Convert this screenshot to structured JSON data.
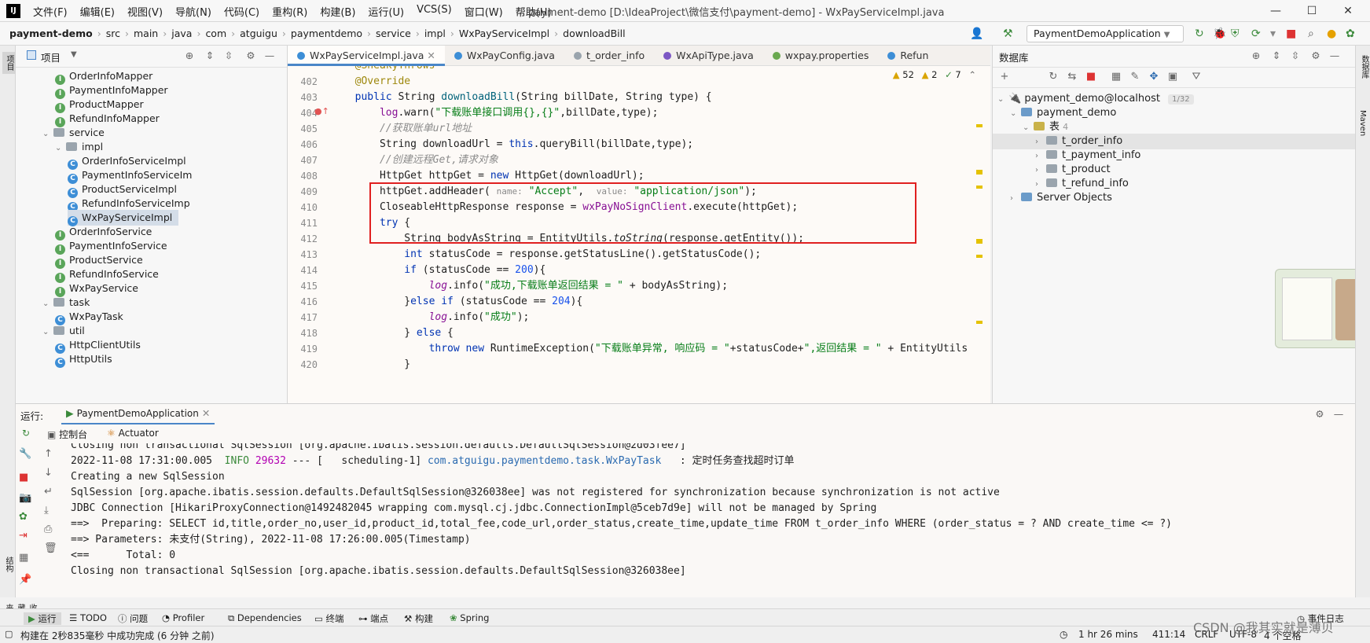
{
  "window": {
    "app_icon": "IJ",
    "title": "payment-demo [D:\\IdeaProject\\微信支付\\payment-demo] - WxPayServiceImpl.java",
    "menu": [
      "文件(F)",
      "编辑(E)",
      "视图(V)",
      "导航(N)",
      "代码(C)",
      "重构(R)",
      "构建(B)",
      "运行(U)",
      "VCS(S)",
      "窗口(W)",
      "帮助(H)"
    ]
  },
  "breadcrumb": [
    "payment-demo",
    "src",
    "main",
    "java",
    "com",
    "atguigu",
    "paymentdemo",
    "service",
    "impl",
    "WxPayServiceImpl",
    "downloadBill"
  ],
  "run_config": "PaymentDemoApplication",
  "project_panel": {
    "title": "项目",
    "tree": [
      {
        "kind": "interface",
        "label": "OrderInfoMapper",
        "indent": 3
      },
      {
        "kind": "interface",
        "label": "PaymentInfoMapper",
        "indent": 3
      },
      {
        "kind": "interface",
        "label": "ProductMapper",
        "indent": 3
      },
      {
        "kind": "interface",
        "label": "RefundInfoMapper",
        "indent": 3
      },
      {
        "kind": "folder",
        "label": "service",
        "indent": 2,
        "open": true
      },
      {
        "kind": "folder",
        "label": "impl",
        "indent": 3,
        "open": true
      },
      {
        "kind": "class",
        "label": "OrderInfoServiceImpl",
        "indent": 4
      },
      {
        "kind": "class",
        "label": "PaymentInfoServiceIm",
        "indent": 4
      },
      {
        "kind": "class",
        "label": "ProductServiceImpl",
        "indent": 4
      },
      {
        "kind": "class",
        "label": "RefundInfoServiceImp",
        "indent": 4
      },
      {
        "kind": "class",
        "label": "WxPayServiceImpl",
        "indent": 4,
        "selected": true
      },
      {
        "kind": "interface",
        "label": "OrderInfoService",
        "indent": 3
      },
      {
        "kind": "interface",
        "label": "PaymentInfoService",
        "indent": 3
      },
      {
        "kind": "interface",
        "label": "ProductService",
        "indent": 3
      },
      {
        "kind": "interface",
        "label": "RefundInfoService",
        "indent": 3
      },
      {
        "kind": "interface",
        "label": "WxPayService",
        "indent": 3
      },
      {
        "kind": "folder",
        "label": "task",
        "indent": 2,
        "open": true
      },
      {
        "kind": "class",
        "label": "WxPayTask",
        "indent": 3
      },
      {
        "kind": "folder",
        "label": "util",
        "indent": 2,
        "open": true
      },
      {
        "kind": "class",
        "label": "HttpClientUtils",
        "indent": 3
      },
      {
        "kind": "class",
        "label": "HttpUtils",
        "indent": 3
      }
    ]
  },
  "editor": {
    "tabs": [
      {
        "label": "WxPayServiceImpl.java",
        "active": true,
        "color": "#3d8ed6"
      },
      {
        "label": "WxPayConfig.java",
        "active": false,
        "color": "#3d8ed6"
      },
      {
        "label": "t_order_info",
        "active": false,
        "color": "#9aa4ad"
      },
      {
        "label": "WxApiType.java",
        "active": false,
        "color": "#7c57c4"
      },
      {
        "label": "wxpay.properties",
        "active": false,
        "color": "#6aa84f"
      },
      {
        "label": "Refun",
        "active": false,
        "color": "#3d8ed6"
      }
    ],
    "inspections": {
      "warnings": "52",
      "weak": "2",
      "ok": "7"
    },
    "line_numbers": [
      "402",
      "403",
      "404",
      "405",
      "406",
      "407",
      "408",
      "409",
      "410",
      "411",
      "412",
      "413",
      "414",
      "415",
      "416",
      "417",
      "418",
      "419",
      "420"
    ]
  },
  "database_panel": {
    "title": "数据库",
    "connection": "payment_demo@localhost",
    "connection_badge": "1/32",
    "schema": "payment_demo",
    "tables_label": "表",
    "tables_count": "4",
    "tables": [
      "t_order_info",
      "t_payment_info",
      "t_product",
      "t_refund_info"
    ],
    "server_objects": "Server Objects"
  },
  "run_panel": {
    "label": "运行:",
    "app": "PaymentDemoApplication",
    "tabs": [
      "控制台",
      "Actuator"
    ],
    "console": [
      {
        "text": "Closing non transactional SqlSession [org.apache.ibatis.session.defaults.DefaultSqlSession@2d03fee7]"
      },
      {
        "parts": [
          {
            "t": "2022-11-08 17:31:00.005  ",
            "c": ""
          },
          {
            "t": "INFO",
            "c": "#3b8a3b"
          },
          {
            "t": " ",
            "c": ""
          },
          {
            "t": "29632",
            "c": "#b200b2"
          },
          {
            "t": " --- [   scheduling-1] ",
            "c": ""
          },
          {
            "t": "com.atguigu.paymentdemo.task.WxPayTask",
            "c": "#2a6ab0"
          },
          {
            "t": "   : 定时任务查找超时订单",
            "c": ""
          }
        ]
      },
      {
        "text": "Creating a new SqlSession"
      },
      {
        "text": "SqlSession [org.apache.ibatis.session.defaults.DefaultSqlSession@326038ee] was not registered for synchronization because synchronization is not active"
      },
      {
        "text": "JDBC Connection [HikariProxyConnection@1492482045 wrapping com.mysql.cj.jdbc.ConnectionImpl@5ceb7d9e] will not be managed by Spring"
      },
      {
        "text": "==>  Preparing: SELECT id,title,order_no,user_id,product_id,total_fee,code_url,order_status,create_time,update_time FROM t_order_info WHERE (order_status = ? AND create_time <= ?)"
      },
      {
        "text": "==> Parameters: 未支付(String), 2022-11-08 17:26:00.005(Timestamp)"
      },
      {
        "text": "<==      Total: 0"
      },
      {
        "text": "Closing non transactional SqlSession [org.apache.ibatis.session.defaults.DefaultSqlSession@326038ee]"
      }
    ]
  },
  "bottom_tools": [
    "运行",
    "TODO",
    "问题",
    "Profiler",
    "Dependencies",
    "终端",
    "端点",
    "构建",
    "Spring"
  ],
  "event_log": "事件日志",
  "status": {
    "message": "构建在 2秒835毫秒 中成功完成 (6 分钟 之前)",
    "time": "1 hr 26 mins",
    "position": "411:14",
    "line_sep": "CRLF",
    "encoding": "UTF-8",
    "indent": "4 个空格"
  },
  "watermark": "CSDN @我其实就是薄贝",
  "left_strip": [
    "项目",
    "结构",
    "收藏夹"
  ],
  "right_strip": [
    "数据库",
    "Maven"
  ]
}
